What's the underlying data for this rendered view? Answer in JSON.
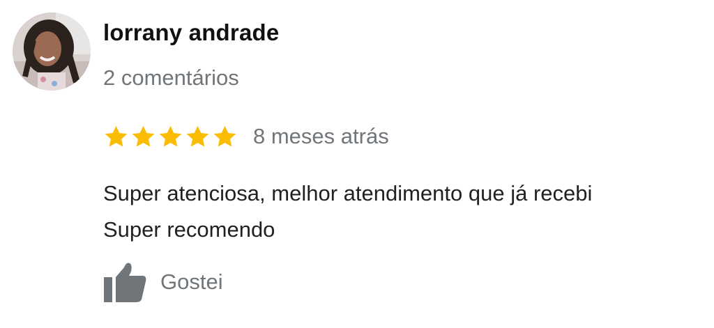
{
  "review": {
    "author": "lorrany andrade",
    "review_count": "2 comentários",
    "rating": 5,
    "rating_max": 5,
    "date": "8 meses atrás",
    "text_lines": [
      "Super atenciosa, melhor atendimento que já recebi",
      "Super recomendo"
    ],
    "like_label": "Gostei"
  },
  "colors": {
    "star": "#fbbc04",
    "secondary_text": "#70757a",
    "thumb_icon": "#70757a"
  },
  "icons": {
    "avatar": "profile-photo",
    "star": "star-icon",
    "like": "thumbs-up-icon"
  }
}
